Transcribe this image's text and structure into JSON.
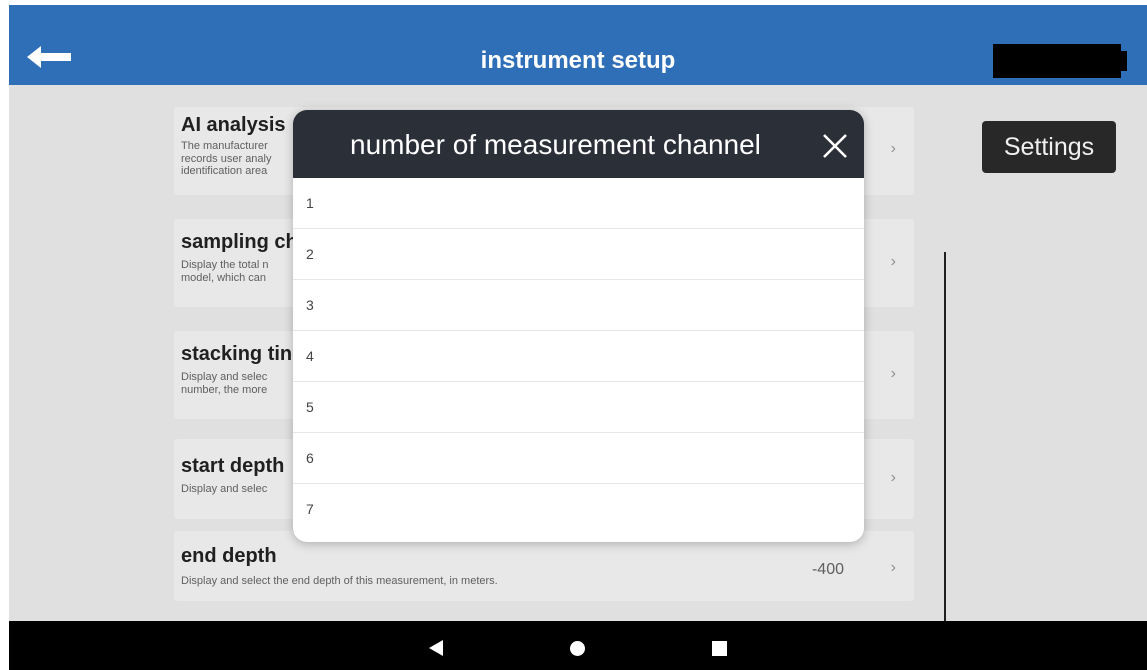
{
  "header": {
    "title": "instrument setup",
    "back_icon": "arrow-left-icon",
    "battery_icon": "battery-icon"
  },
  "settings_button": "Settings",
  "cards": [
    {
      "title": "AI analysis",
      "desc_lines": [
        "The manufacturer",
        "records user analy",
        "identification area"
      ],
      "value": ""
    },
    {
      "title": "sampling ch",
      "desc_lines": [
        "Display the total n",
        "model, which can"
      ],
      "value": ""
    },
    {
      "title": "stacking tin",
      "desc_lines": [
        "Display and selec",
        "number, the more"
      ],
      "value": ""
    },
    {
      "title": "start depth",
      "desc_lines": [
        "Display and selec"
      ],
      "value": ""
    },
    {
      "title": "end depth",
      "desc_lines": [
        "Display and select the end depth of this measurement, in meters."
      ],
      "value": "-400"
    }
  ],
  "modal": {
    "title": "number of measurement channel",
    "close_icon": "close-icon",
    "options": [
      "1",
      "2",
      "3",
      "4",
      "5",
      "6",
      "7"
    ]
  },
  "navbar": {
    "back_icon": "nav-back-triangle-icon",
    "home_icon": "nav-home-circle-icon",
    "recent_icon": "nav-recent-square-icon"
  },
  "colors": {
    "header": "#2f6fb8",
    "modal_header": "#2b2f38",
    "settings_button": "#2b2b2b"
  }
}
